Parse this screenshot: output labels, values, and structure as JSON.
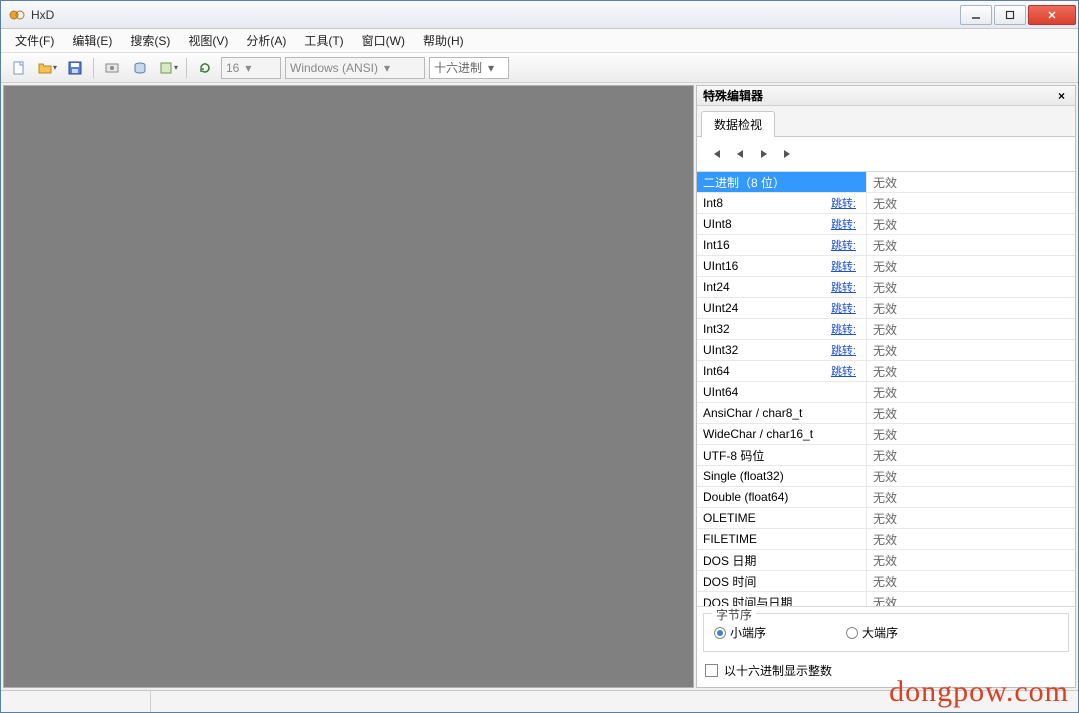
{
  "title": "HxD",
  "menu": [
    "文件(F)",
    "编辑(E)",
    "搜索(S)",
    "视图(V)",
    "分析(A)",
    "工具(T)",
    "窗口(W)",
    "帮助(H)"
  ],
  "toolbar": {
    "bytes_per_row": "16",
    "encoding": "Windows (ANSI)",
    "number_base": "十六进制"
  },
  "sidepanel": {
    "title": "特殊编辑器",
    "tab": "数据检视",
    "jump_label": "跳转:",
    "rows": [
      {
        "name": "二进制（8 位）",
        "value": "无效",
        "jump": false,
        "selected": true
      },
      {
        "name": "Int8",
        "value": "无效",
        "jump": true
      },
      {
        "name": "UInt8",
        "value": "无效",
        "jump": true
      },
      {
        "name": "Int16",
        "value": "无效",
        "jump": true
      },
      {
        "name": "UInt16",
        "value": "无效",
        "jump": true
      },
      {
        "name": "Int24",
        "value": "无效",
        "jump": true
      },
      {
        "name": "UInt24",
        "value": "无效",
        "jump": true
      },
      {
        "name": "Int32",
        "value": "无效",
        "jump": true
      },
      {
        "name": "UInt32",
        "value": "无效",
        "jump": true
      },
      {
        "name": "Int64",
        "value": "无效",
        "jump": true
      },
      {
        "name": "UInt64",
        "value": "无效",
        "jump": false
      },
      {
        "name": "AnsiChar / char8_t",
        "value": "无效",
        "jump": false
      },
      {
        "name": "WideChar / char16_t",
        "value": "无效",
        "jump": false
      },
      {
        "name": "UTF-8 码位",
        "value": "无效",
        "jump": false
      },
      {
        "name": "Single (float32)",
        "value": "无效",
        "jump": false
      },
      {
        "name": "Double (float64)",
        "value": "无效",
        "jump": false
      },
      {
        "name": "OLETIME",
        "value": "无效",
        "jump": false
      },
      {
        "name": "FILETIME",
        "value": "无效",
        "jump": false
      },
      {
        "name": "DOS 日期",
        "value": "无效",
        "jump": false
      },
      {
        "name": "DOS 时间",
        "value": "无效",
        "jump": false
      },
      {
        "name": "DOS 时间与日期",
        "value": "无效",
        "jump": false
      }
    ],
    "endian": {
      "legend": "字节序",
      "little": "小端序",
      "big": "大端序",
      "selected": "little"
    },
    "hex_checkbox": "以十六进制显示整数"
  },
  "watermark": "dongpow.com"
}
